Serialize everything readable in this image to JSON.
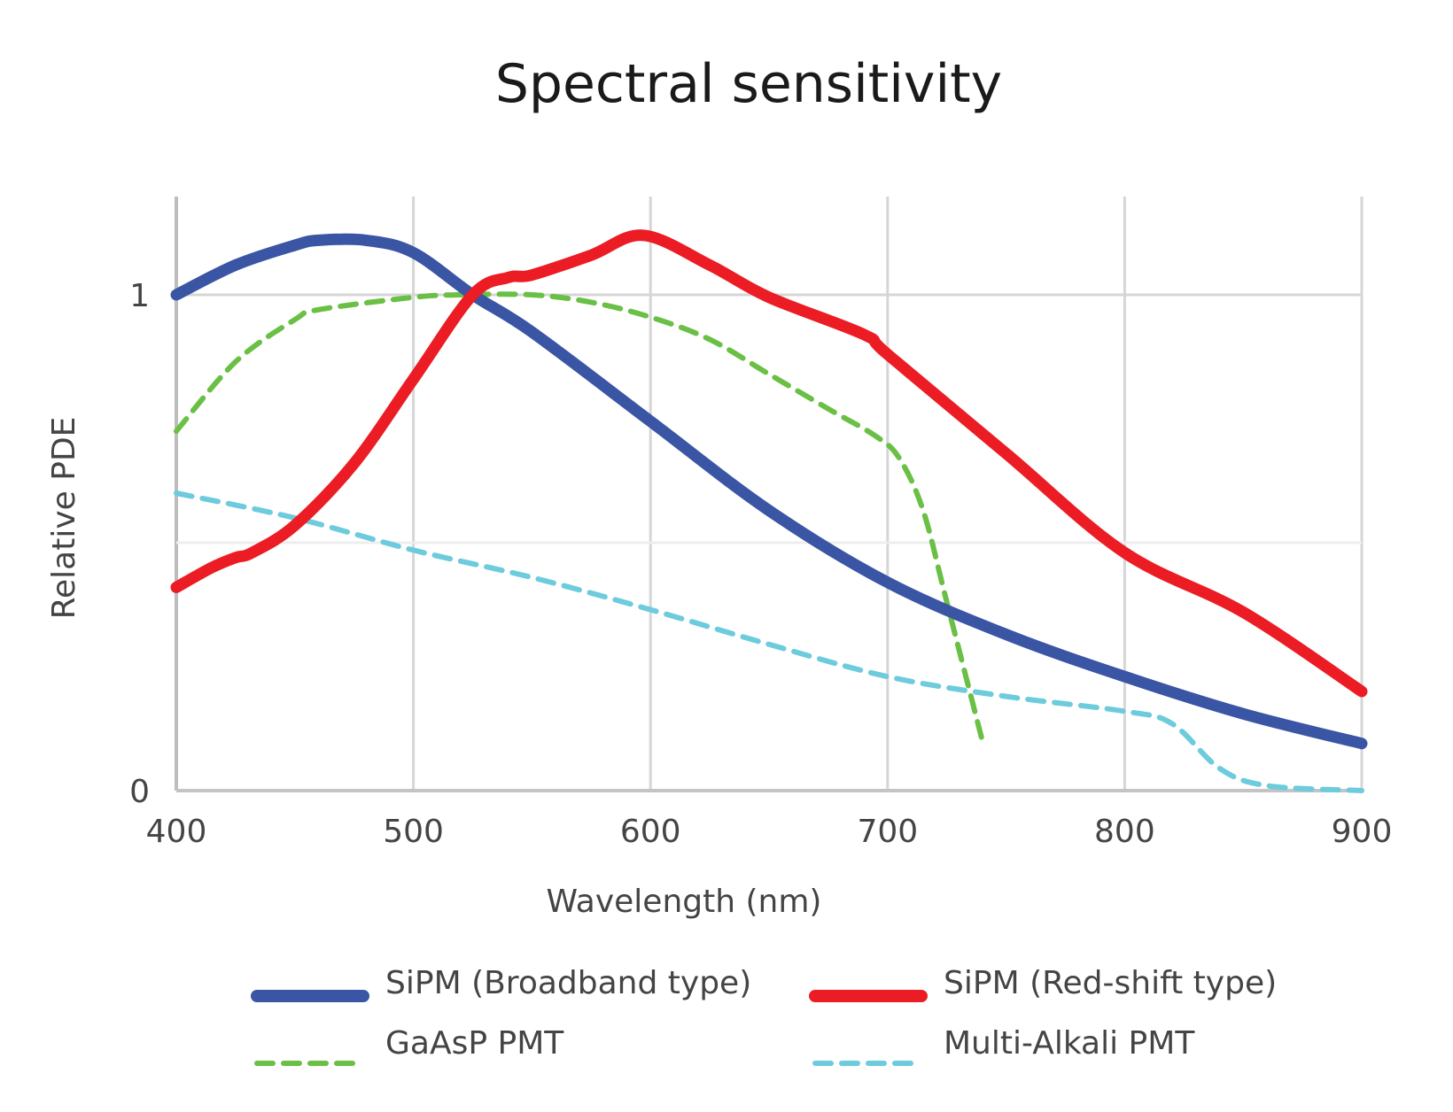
{
  "chart_data": {
    "type": "line",
    "title": "Spectral sensitivity",
    "xlabel": "Wavelength (nm)",
    "ylabel": "Relative PDE",
    "xlim": [
      400,
      900
    ],
    "ylim": [
      0,
      1.2
    ],
    "x_ticks": [
      400,
      500,
      600,
      700,
      800,
      900
    ],
    "x_tick_labels": [
      "400",
      "500",
      "600",
      "700",
      "800",
      "900"
    ],
    "y_ticks": [
      0,
      0.5,
      1
    ],
    "y_tick_labels": [
      "0",
      "",
      "1"
    ],
    "grid": true,
    "legend_position": "bottom",
    "series": [
      {
        "name": "SiPM (Broadband type)",
        "color": "#3a55a4",
        "style": "solid",
        "x": [
          400,
          425,
          450,
          460,
          480,
          500,
          525,
          550,
          600,
          650,
          700,
          750,
          800,
          850,
          900
        ],
        "y": [
          1.0,
          1.06,
          1.1,
          1.11,
          1.11,
          1.085,
          1.0,
          0.925,
          0.745,
          0.565,
          0.42,
          0.315,
          0.23,
          0.155,
          0.095
        ]
      },
      {
        "name": "SiPM (Red-shift type)",
        "color": "#ec1c24",
        "style": "solid",
        "x": [
          400,
          415,
          425,
          432,
          450,
          475,
          500,
          525,
          540,
          550,
          575,
          597,
          625,
          650,
          690,
          700,
          750,
          800,
          850,
          900
        ],
        "y": [
          0.41,
          0.45,
          0.47,
          0.48,
          0.535,
          0.66,
          0.83,
          1.0,
          1.035,
          1.04,
          1.08,
          1.12,
          1.06,
          0.995,
          0.92,
          0.88,
          0.68,
          0.48,
          0.36,
          0.2
        ]
      },
      {
        "name": "GaAsP PMT",
        "color": "#6abf45",
        "style": "dashed",
        "x": [
          400,
          425,
          450,
          460,
          500,
          520,
          550,
          575,
          600,
          625,
          650,
          675,
          695,
          705,
          715,
          725,
          740
        ],
        "y": [
          0.725,
          0.865,
          0.95,
          0.97,
          0.995,
          1.0,
          1.0,
          0.985,
          0.955,
          0.91,
          0.84,
          0.77,
          0.715,
          0.67,
          0.565,
          0.38,
          0.1
        ]
      },
      {
        "name": "Multi-Alkali PMT",
        "color": "#6ccbdc",
        "style": "dashed",
        "x": [
          400,
          450,
          500,
          550,
          600,
          650,
          700,
          750,
          800,
          820,
          840,
          860,
          900
        ],
        "y": [
          0.6,
          0.55,
          0.485,
          0.43,
          0.365,
          0.295,
          0.23,
          0.19,
          0.16,
          0.135,
          0.045,
          0.01,
          0.0
        ]
      }
    ]
  }
}
